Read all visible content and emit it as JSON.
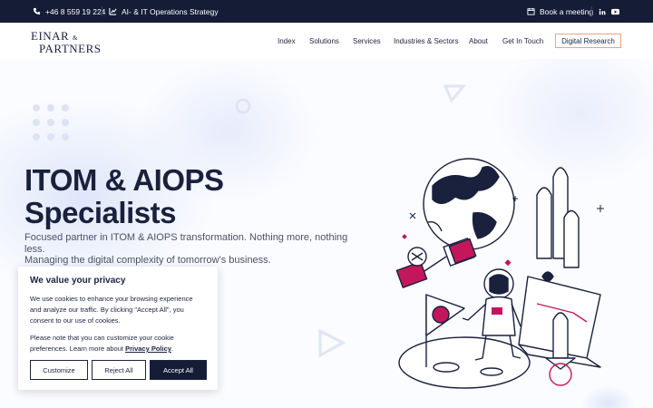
{
  "topbar": {
    "phone": "+46 8 559 19 224",
    "tagline": "AI- & IT Operations Strategy",
    "meeting": "Book a meeting",
    "social": [
      "linkedin-icon",
      "youtube-icon"
    ]
  },
  "header": {
    "logo_line1": "EINAR",
    "logo_amp": "&",
    "logo_line2": "PARTNERS",
    "nav": [
      "Index",
      "Solutions",
      "Services",
      "Industries & Sectors",
      "About",
      "Get In Touch"
    ],
    "cta": "Digital Research"
  },
  "hero": {
    "title_line1": "ITOM & AIOPS",
    "title_line2": "Specialists",
    "subtitle_line1": "Focused partner in ITOM & AIOPS transformation. Nothing more, nothing less.",
    "subtitle_line2": "Managing the digital complexity of tomorrow's business."
  },
  "cookie": {
    "title": "We value your privacy",
    "text1": "We use cookies to enhance your browsing experience and analyze our traffic. By clicking \"Accept All\", you consent to our use of cookies.",
    "text2_prefix": "Please note that you can customize your cookie preferences. Learn more about ",
    "link": "Privacy Policy",
    "text2_suffix": ".",
    "customize": "Customize",
    "reject": "Reject All",
    "accept": "Accept All"
  },
  "colors": {
    "navy": "#141c36",
    "accent_orange": "#e8a57a",
    "accent_pink": "#c2185b"
  }
}
